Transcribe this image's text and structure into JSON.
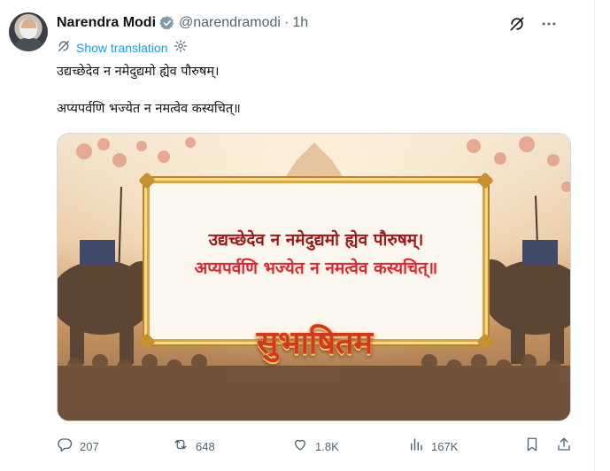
{
  "author": {
    "name": "Narendra Modi",
    "handle": "@narendramodi",
    "separator": "·",
    "time": "1h",
    "verified": true
  },
  "icons": {
    "verified": "verified-badge-icon",
    "grok": "grok-icon",
    "more": "more-icon",
    "translate": "translate-icon",
    "settings": "gear-icon"
  },
  "translation": {
    "label": "Show translation"
  },
  "tweet_text": {
    "line1": "उद्यच्छेदेव न नमेदुद्यमो ह्येव पौरुषम्।",
    "line2": "अप्यपर्वणि भज्येत न नमत्वेव कस्यचित्॥"
  },
  "image": {
    "line1": "उद्यच्छेदेव न नमेदुद्यमो ह्येव पौरुषम्।",
    "line2": "अप्यपर्वणि भज्येत न नमत्वेव कस्यचित्॥",
    "title": "सुभाषितम"
  },
  "actions": {
    "replies": "207",
    "reposts": "648",
    "likes": "1.8K",
    "views": "167K"
  },
  "colors": {
    "accent": "#1d9bf0",
    "muted": "#536471",
    "text": "#0f1419",
    "verified": "#829aab",
    "card_line1": "#a21816",
    "card_line2": "#e3262e"
  }
}
